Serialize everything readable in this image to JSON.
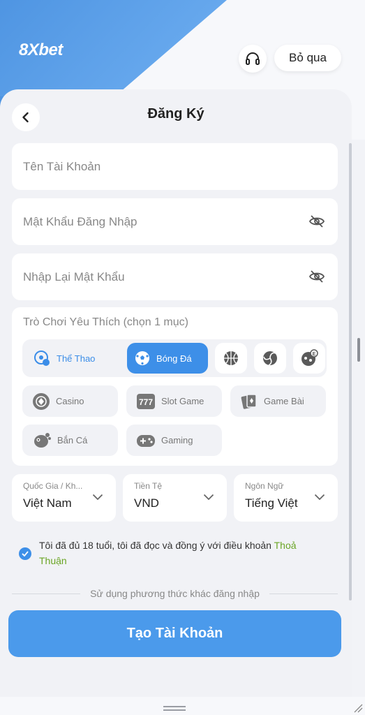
{
  "header": {
    "logo_text": "8Xbet",
    "skip_label": "Bỏ qua"
  },
  "page": {
    "title": "Đăng Ký"
  },
  "form": {
    "username_placeholder": "Tên Tài Khoản",
    "password_placeholder": "Mật Khẩu Đăng Nhập",
    "confirm_password_placeholder": "Nhập Lại Mật Khẩu"
  },
  "games": {
    "title": "Trò Chơi Yêu Thích (chọn 1 mục)",
    "tabs": [
      {
        "label": "Thể Thao",
        "icon": "sports-icon"
      },
      {
        "label": "Bóng Đá",
        "icon": "soccer-ball-icon",
        "selected": true
      },
      {
        "icon": "basketball-icon"
      },
      {
        "icon": "volleyball-icon"
      },
      {
        "icon": "esports-icon"
      }
    ],
    "categories": [
      {
        "label": "Casino",
        "icon": "casino-chip-icon"
      },
      {
        "label": "Slot Game",
        "icon": "slot-777-icon"
      },
      {
        "label": "Game Bài",
        "icon": "cards-icon"
      },
      {
        "label": "Bắn Cá",
        "icon": "fish-icon"
      },
      {
        "label": "Gaming",
        "icon": "gamepad-icon"
      }
    ]
  },
  "selects": {
    "country": {
      "label": "Quốc Gia / Kh...",
      "value": "Việt Nam"
    },
    "currency": {
      "label": "Tiền Tệ",
      "value": "VND"
    },
    "language": {
      "label": "Ngôn Ngữ",
      "value": "Tiếng Việt"
    }
  },
  "agreement": {
    "text": "Tôi đã đủ 18 tuổi, tôi đã đọc và đồng ý với điều khoản ",
    "link": "Thoả Thuận",
    "checked": true
  },
  "divider_text": "Sử dụng phương thức khác đăng nhập",
  "submit_label": "Tạo Tài Khoản",
  "colors": {
    "brand_blue": "#4b9aeb",
    "link_green": "#6aa525"
  }
}
